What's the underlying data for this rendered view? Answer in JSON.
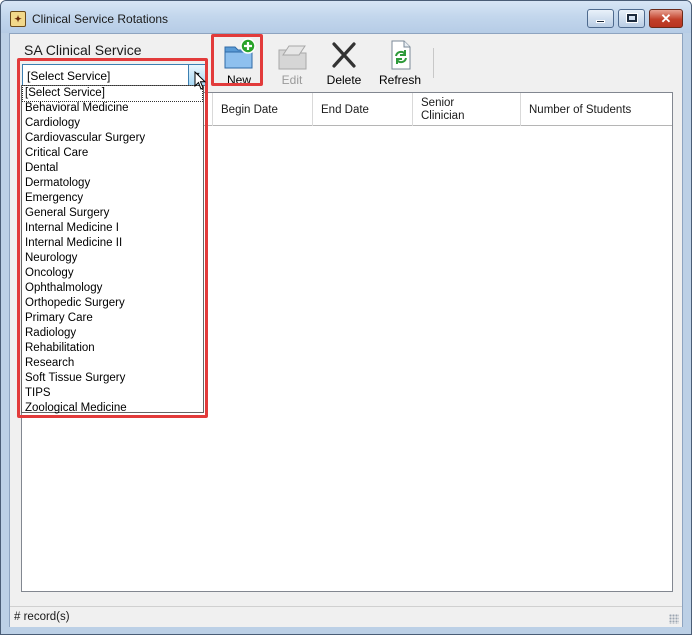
{
  "window": {
    "title": "Clinical Service Rotations",
    "icon": "app-icon",
    "controls": {
      "minimize": "minimize-icon",
      "maximize": "maximize-icon",
      "close": "close-icon"
    }
  },
  "service_selector": {
    "label": "SA Clinical Service",
    "selected_value": "[Select Service]",
    "options": [
      "[Select Service]",
      "Behavioral Medicine",
      "Cardiology",
      "Cardiovascular Surgery",
      "Critical Care",
      "Dental",
      "Dermatology",
      "Emergency",
      "General Surgery",
      "Internal Medicine I",
      "Internal Medicine II",
      "Neurology",
      "Oncology",
      "Ophthalmology",
      "Orthopedic Surgery",
      "Primary Care",
      "Radiology",
      "Rehabilitation",
      "Research",
      "Soft Tissue Surgery",
      "TIPS",
      "Zoological Medicine"
    ]
  },
  "toolbar": {
    "new_label": "New",
    "edit_label": "Edit",
    "delete_label": "Delete",
    "refresh_label": "Refresh",
    "icons": {
      "new": "new-folder-icon",
      "edit": "edit-folder-icon",
      "delete": "delete-x-icon",
      "refresh": "refresh-icon"
    }
  },
  "grid": {
    "columns": [
      "Begin Date",
      "End Date",
      "Senior Clinician",
      "Number of Students"
    ],
    "senior_clinician_line1": "Senior",
    "senior_clinician_line2": "Clinician",
    "rows": []
  },
  "statusbar": {
    "text": "# record(s)"
  },
  "colors": {
    "highlight": "#e23b3b",
    "window_frame": "#bcd0e6",
    "combo_border": "#3c7fb1",
    "new_icon_plus": "#2aa32a",
    "refresh_icon": "#2e9a3a"
  }
}
